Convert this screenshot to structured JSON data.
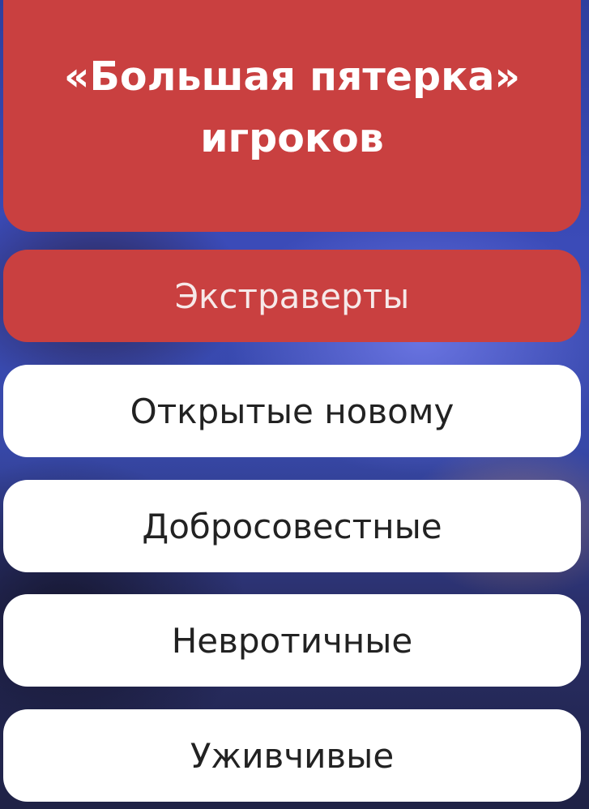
{
  "title": {
    "line1": "«Большая пятерка»",
    "line2": "игроков"
  },
  "options": [
    {
      "label": "Экстраверты",
      "selected": true
    },
    {
      "label": "Открытые новому",
      "selected": false
    },
    {
      "label": "Добросовестные",
      "selected": false
    },
    {
      "label": "Невротичные",
      "selected": false
    },
    {
      "label": "Уживчивые",
      "selected": false
    }
  ],
  "colors": {
    "accent_red": "#c94040",
    "option_white": "#ffffff",
    "text_dark": "#222222"
  }
}
